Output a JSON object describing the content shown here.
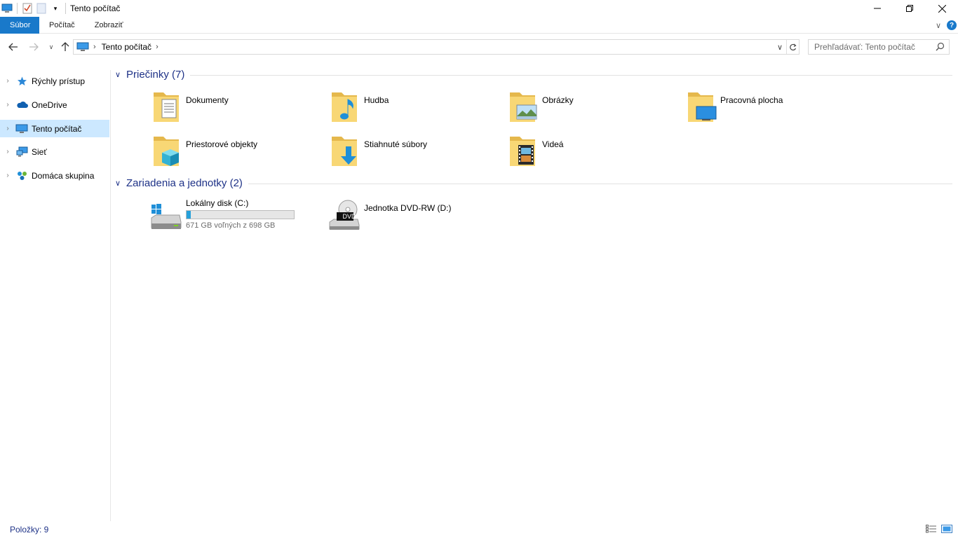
{
  "window": {
    "title": "Tento počítač",
    "minimize_icon": "minimize-icon",
    "restore_icon": "restore-icon",
    "close_icon": "close-icon"
  },
  "ribbon": {
    "tabs": [
      {
        "label": "Súbor",
        "active": true
      },
      {
        "label": "Počítač"
      },
      {
        "label": "Zobraziť"
      }
    ],
    "help_label": "?"
  },
  "address": {
    "segment": "Tento počítač",
    "search_placeholder": "Prehľadávať: Tento počítač"
  },
  "sidebar": {
    "items": [
      {
        "label": "Rýchly prístup",
        "icon": "star-icon"
      },
      {
        "label": "OneDrive",
        "icon": "cloud-icon"
      },
      {
        "label": "Tento počítač",
        "icon": "computer-icon",
        "selected": true
      },
      {
        "label": "Sieť",
        "icon": "network-icon"
      },
      {
        "label": "Domáca skupina",
        "icon": "homegroup-icon"
      }
    ]
  },
  "folders": {
    "header": "Priečinky (7)",
    "items": [
      {
        "label": "Dokumenty",
        "icon": "documents-folder-icon"
      },
      {
        "label": "Hudba",
        "icon": "music-folder-icon"
      },
      {
        "label": "Obrázky",
        "icon": "pictures-folder-icon"
      },
      {
        "label": "Pracovná plocha",
        "icon": "desktop-folder-icon"
      },
      {
        "label": "Priestorové objekty",
        "icon": "3d-objects-folder-icon"
      },
      {
        "label": "Stiahnuté súbory",
        "icon": "downloads-folder-icon"
      },
      {
        "label": "Videá",
        "icon": "videos-folder-icon"
      }
    ]
  },
  "drives": {
    "header": "Zariadenia a jednotky (2)",
    "items": [
      {
        "label": "Lokálny disk (C:)",
        "free_text": "671 GB voľných z 698 GB",
        "used_fraction": 0.0387,
        "icon": "hard-drive-icon"
      },
      {
        "label": "Jednotka DVD-RW (D:)",
        "icon": "dvd-drive-icon",
        "badge": "DVD"
      }
    ]
  },
  "status": {
    "items_count": "Položky: 9"
  },
  "colors": {
    "accent": "#1979ca",
    "group_header": "#1e3287",
    "selection": "#cce8ff",
    "drive_fill": "#26a0da"
  }
}
